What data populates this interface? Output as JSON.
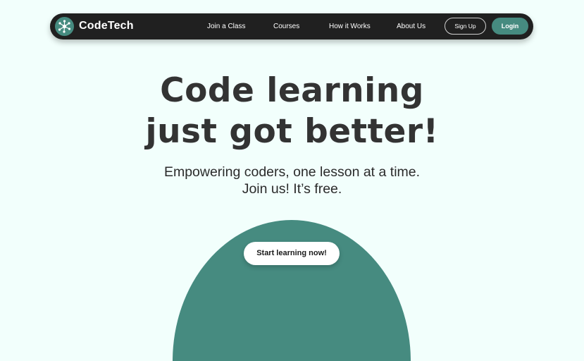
{
  "brand": {
    "name": "CodeTech",
    "logo_icon": "network-nodes-icon"
  },
  "nav": {
    "links": [
      "Join a Class",
      "Courses",
      "How it Works",
      "About Us"
    ],
    "signup_label": "Sign Up",
    "login_label": "Login"
  },
  "hero": {
    "title_line1": "Code learning",
    "title_line2": "just got better!",
    "subtitle_line1": "Empowering coders, one lesson at a time.",
    "subtitle_line2": "Join us! It’s free."
  },
  "cta": {
    "label": "Start learning now!"
  },
  "colors": {
    "accent": "#468b80",
    "navbar_bg": "#202020",
    "page_bg": "#f2fffc",
    "text_dark": "#333333"
  }
}
